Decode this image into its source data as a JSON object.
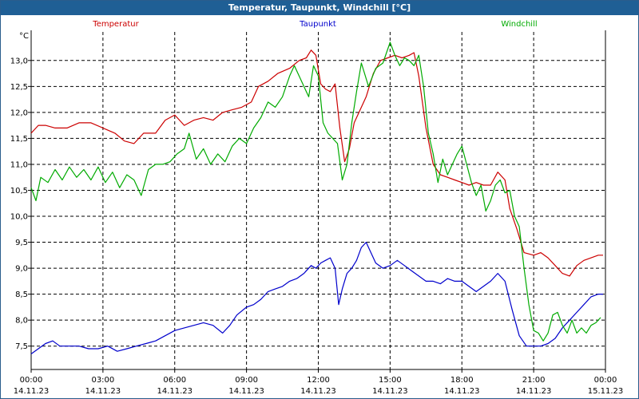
{
  "window": {
    "title": "Temperatur, Taupunkt, Windchill [°C]"
  },
  "chart_data": {
    "type": "line",
    "title": "Temperatur, Taupunkt, Windchill [°C]",
    "ylabel": "°C",
    "xlabel": "",
    "ylim": [
      7.05,
      13.55
    ],
    "yticks": [
      "7,5",
      "8,0",
      "8,5",
      "9,0",
      "9,5",
      "10,0",
      "10,5",
      "11,0",
      "11,5",
      "12,0",
      "12,5",
      "13,0"
    ],
    "ytick_values": [
      7.5,
      8.0,
      8.5,
      9.0,
      9.5,
      10.0,
      10.5,
      11.0,
      11.5,
      12.0,
      12.5,
      13.0
    ],
    "xlim": [
      0,
      24
    ],
    "xtick_hours": [
      0,
      3,
      6,
      9,
      12,
      15,
      18,
      21,
      24
    ],
    "xticks_time": [
      "00:00",
      "03:00",
      "06:00",
      "09:00",
      "12:00",
      "15:00",
      "18:00",
      "21:00",
      "00:00"
    ],
    "xticks_date": [
      "14.11.23",
      "14.11.23",
      "14.11.23",
      "14.11.23",
      "14.11.23",
      "14.11.23",
      "14.11.23",
      "14.11.23",
      "15.11.23"
    ],
    "grid": true,
    "legend_position": "top",
    "series": [
      {
        "name": "Temperatur",
        "color": "#cc0000",
        "x": [
          0,
          0.3,
          0.6,
          1,
          1.5,
          2,
          2.5,
          3,
          3.5,
          3.9,
          4.3,
          4.7,
          5.2,
          5.6,
          6,
          6.4,
          6.8,
          7.2,
          7.6,
          8,
          8.4,
          8.8,
          9.2,
          9.5,
          9.9,
          10.3,
          10.8,
          11.2,
          11.5,
          11.7,
          11.9,
          12.1,
          12.3,
          12.5,
          12.7,
          12.9,
          13.1,
          13.3,
          13.5,
          13.7,
          14,
          14.3,
          14.6,
          14.9,
          15.2,
          15.5,
          15.8,
          16,
          16.2,
          16.5,
          16.8,
          17.1,
          17.4,
          17.7,
          18,
          18.3,
          18.6,
          18.9,
          19.2,
          19.5,
          19.8,
          20,
          20.3,
          20.6,
          21,
          21.3,
          21.6,
          21.9,
          22.2,
          22.5,
          22.8,
          23.1,
          23.4,
          23.7,
          23.9
        ],
        "y": [
          11.6,
          11.75,
          11.75,
          11.7,
          11.7,
          11.8,
          11.8,
          11.7,
          11.6,
          11.45,
          11.4,
          11.6,
          11.6,
          11.85,
          11.95,
          11.75,
          11.85,
          11.9,
          11.85,
          12.0,
          12.05,
          12.1,
          12.2,
          12.5,
          12.6,
          12.75,
          12.85,
          13.0,
          13.05,
          13.2,
          13.1,
          12.55,
          12.45,
          12.4,
          12.55,
          11.7,
          11.05,
          11.3,
          11.8,
          12.0,
          12.3,
          12.75,
          13.0,
          13.05,
          13.1,
          13.05,
          13.1,
          13.15,
          12.7,
          11.7,
          11.0,
          10.8,
          10.75,
          10.7,
          10.65,
          10.6,
          10.65,
          10.6,
          10.6,
          10.85,
          10.7,
          10.15,
          9.75,
          9.3,
          9.25,
          9.3,
          9.2,
          9.05,
          8.9,
          8.85,
          9.05,
          9.15,
          9.2,
          9.25,
          9.25
        ]
      },
      {
        "name": "Taupunkt",
        "color": "#0000cc",
        "x": [
          0,
          0.3,
          0.6,
          0.9,
          1.2,
          1.6,
          2,
          2.4,
          2.8,
          3.2,
          3.6,
          4,
          4.4,
          4.8,
          5.2,
          5.6,
          6,
          6.4,
          6.8,
          7.2,
          7.6,
          8,
          8.3,
          8.6,
          9,
          9.3,
          9.6,
          9.9,
          10.2,
          10.5,
          10.8,
          11.1,
          11.4,
          11.7,
          11.9,
          12.1,
          12.3,
          12.5,
          12.7,
          12.85,
          13,
          13.2,
          13.4,
          13.6,
          13.8,
          14,
          14.2,
          14.4,
          14.7,
          15,
          15.3,
          15.6,
          15.9,
          16.2,
          16.5,
          16.8,
          17.1,
          17.4,
          17.7,
          18,
          18.3,
          18.6,
          18.9,
          19.2,
          19.5,
          19.8,
          20.1,
          20.4,
          20.7,
          21,
          21.3,
          21.6,
          21.9,
          22.2,
          22.5,
          22.8,
          23.1,
          23.4,
          23.7,
          23.9
        ],
        "y": [
          7.35,
          7.45,
          7.55,
          7.6,
          7.5,
          7.5,
          7.5,
          7.45,
          7.45,
          7.5,
          7.4,
          7.45,
          7.5,
          7.55,
          7.6,
          7.7,
          7.8,
          7.85,
          7.9,
          7.95,
          7.9,
          7.75,
          7.9,
          8.1,
          8.25,
          8.3,
          8.4,
          8.55,
          8.6,
          8.65,
          8.75,
          8.8,
          8.9,
          9.05,
          9.0,
          9.1,
          9.15,
          9.2,
          9.0,
          8.3,
          8.6,
          8.9,
          9.0,
          9.15,
          9.4,
          9.5,
          9.3,
          9.1,
          9.0,
          9.05,
          9.15,
          9.05,
          8.95,
          8.85,
          8.75,
          8.75,
          8.7,
          8.8,
          8.75,
          8.75,
          8.65,
          8.55,
          8.65,
          8.75,
          8.9,
          8.75,
          8.2,
          7.7,
          7.5,
          7.5,
          7.5,
          7.55,
          7.65,
          7.85,
          8.0,
          8.15,
          8.3,
          8.45,
          8.5,
          8.5
        ]
      },
      {
        "name": "Windchill",
        "color": "#00aa00",
        "x": [
          0,
          0.2,
          0.4,
          0.7,
          1,
          1.3,
          1.6,
          1.9,
          2.2,
          2.5,
          2.8,
          3.1,
          3.4,
          3.7,
          4,
          4.3,
          4.6,
          4.9,
          5.2,
          5.5,
          5.8,
          6.1,
          6.4,
          6.6,
          6.9,
          7.2,
          7.5,
          7.8,
          8.1,
          8.4,
          8.7,
          9,
          9.3,
          9.6,
          9.9,
          10.2,
          10.5,
          10.8,
          11,
          11.3,
          11.6,
          11.8,
          12,
          12.2,
          12.4,
          12.6,
          12.8,
          13,
          13.2,
          13.4,
          13.6,
          13.8,
          14.1,
          14.4,
          14.7,
          15,
          15.2,
          15.4,
          15.6,
          15.8,
          16,
          16.2,
          16.4,
          16.6,
          16.8,
          17,
          17.2,
          17.4,
          17.6,
          17.8,
          18,
          18.2,
          18.4,
          18.6,
          18.8,
          19,
          19.2,
          19.4,
          19.6,
          19.8,
          20,
          20.2,
          20.4,
          20.6,
          20.8,
          21,
          21.2,
          21.4,
          21.6,
          21.8,
          22,
          22.2,
          22.4,
          22.6,
          22.8,
          23,
          23.2,
          23.4,
          23.6,
          23.8
        ],
        "y": [
          10.55,
          10.3,
          10.75,
          10.65,
          10.9,
          10.7,
          10.95,
          10.75,
          10.9,
          10.7,
          10.95,
          10.65,
          10.85,
          10.55,
          10.8,
          10.7,
          10.4,
          10.9,
          11.0,
          11.0,
          11.05,
          11.2,
          11.3,
          11.6,
          11.1,
          11.3,
          11.0,
          11.2,
          11.05,
          11.35,
          11.5,
          11.4,
          11.7,
          11.9,
          12.2,
          12.1,
          12.3,
          12.7,
          12.9,
          12.6,
          12.3,
          12.9,
          12.7,
          11.8,
          11.6,
          11.5,
          11.4,
          10.7,
          11.0,
          11.8,
          12.4,
          12.95,
          12.5,
          12.85,
          12.95,
          13.35,
          13.1,
          12.9,
          13.05,
          13.0,
          12.9,
          13.1,
          12.5,
          11.6,
          11.2,
          10.65,
          11.1,
          10.8,
          11.0,
          11.2,
          11.35,
          11.0,
          10.65,
          10.4,
          10.6,
          10.1,
          10.3,
          10.6,
          10.7,
          10.45,
          10.5,
          10.0,
          9.8,
          9.0,
          8.3,
          7.8,
          7.75,
          7.6,
          7.75,
          8.1,
          8.15,
          7.9,
          7.75,
          8.0,
          7.75,
          7.85,
          7.75,
          7.9,
          7.95,
          8.05
        ]
      }
    ]
  }
}
